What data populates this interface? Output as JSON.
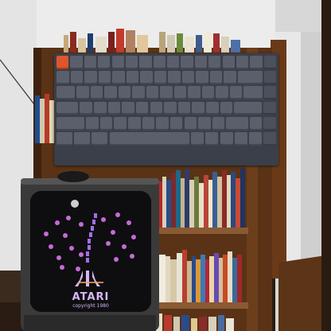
{
  "scene": {
    "description_label": "Photo of a mechanical keyboard overlaid on a bookshelf with an old CRT TV playing an Atari game"
  },
  "tv": {
    "brand_text": "ATARI",
    "copyright_text": "copyright 1980"
  },
  "colors": {
    "keyboard_body": "#3a3f49",
    "key": "#5a5f6b",
    "esc_key": "#e0552b",
    "tv_body": "#3c3c3c",
    "screen_sprites": "#d36fe0"
  }
}
